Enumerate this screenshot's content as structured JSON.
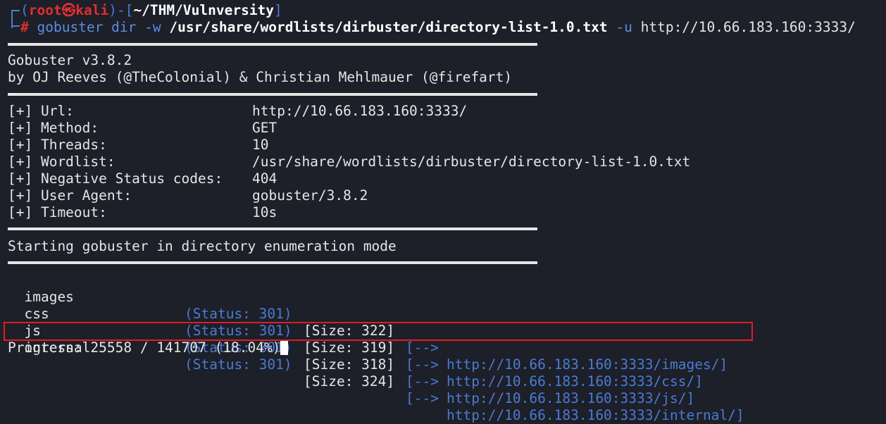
{
  "prompt": {
    "open_paren": "(",
    "user": "root",
    "at_symbol": "㉿",
    "host": "kali",
    "close_paren": ")",
    "dash": "-",
    "dir_open": "[",
    "cwd": "~/THM/Vulnversity",
    "dir_close": "]",
    "hash": "#",
    "cmd_name": "gobuster",
    "subcommand": "dir",
    "flag_w": "-w",
    "wordlist_arg": "/usr/share/wordlists/dirbuster/directory-list-1.0.txt",
    "flag_u": "-u",
    "url_arg": "http://10.66.183.160:3333/"
  },
  "banner": {
    "version": "Gobuster v3.8.2",
    "authors": "by OJ Reeves (@TheColonial) & Christian Mehlmauer (@firefart)"
  },
  "config": [
    {
      "label": "[+] Url:",
      "value": "http://10.66.183.160:3333/"
    },
    {
      "label": "[+] Method:",
      "value": "GET"
    },
    {
      "label": "[+] Threads:",
      "value": "10"
    },
    {
      "label": "[+] Wordlist:",
      "value": "/usr/share/wordlists/dirbuster/directory-list-1.0.txt"
    },
    {
      "label": "[+] Negative Status codes:",
      "value": "404"
    },
    {
      "label": "[+] User Agent:",
      "value": "gobuster/3.8.2"
    },
    {
      "label": "[+] Timeout:",
      "value": "10s"
    }
  ],
  "start_msg": "Starting gobuster in directory enumeration mode",
  "results": [
    {
      "path": "images",
      "status": "(Status: 301)",
      "size": "[Size: 322]",
      "arrow": "[-->",
      "url": "http://10.66.183.160:3333/images/]"
    },
    {
      "path": "css",
      "status": "(Status: 301)",
      "size": "[Size: 319]",
      "arrow": "[-->",
      "url": "http://10.66.183.160:3333/css/]"
    },
    {
      "path": "js",
      "status": "(Status: 301)",
      "size": "[Size: 318]",
      "arrow": "[-->",
      "url": "http://10.66.183.160:3333/js/]"
    },
    {
      "path": "internal",
      "status": "(Status: 301)",
      "size": "[Size: 324]",
      "arrow": "[-->",
      "url": "http://10.66.183.160:3333/internal/]"
    }
  ],
  "progress": "Progress: 25558 / 141707 (18.04%)",
  "colors": {
    "background": "#1d1f29",
    "prompt_blue": "#4a7cd1",
    "root_red": "#e02f2f",
    "highlight_red": "#e01e1e"
  }
}
